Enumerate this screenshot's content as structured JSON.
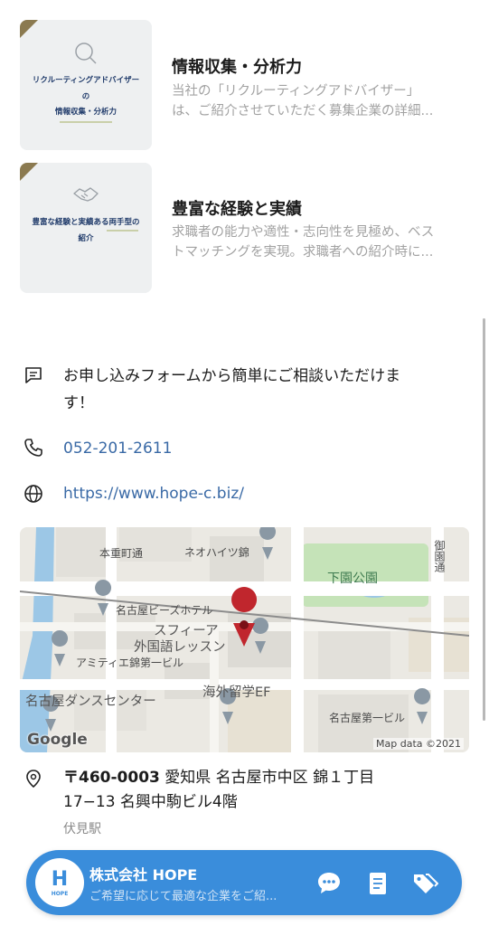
{
  "cards": [
    {
      "thumb_text_1": "リクルーティングアドバイザー",
      "thumb_text_2": "の",
      "thumb_text_3": "情報収集・分析力",
      "title": "情報収集・分析力",
      "desc_1": "当社の「リクルーティングアドバイザー」",
      "desc_2": "は、ご紹介させていただく募集企業の詳細..."
    },
    {
      "thumb_text_1": "豊富な経験と実績ある両手型の",
      "thumb_text_2": "紹介",
      "title": "豊富な経験と実績",
      "desc_1": "求職者の能力や適性・志向性を見極め、ベス",
      "desc_2": "トマッチングを実現。求職者への紹介時に..."
    }
  ],
  "contact": {
    "message_1": "お申し込みフォームから簡単にご相談いただけま",
    "message_2": "す！",
    "phone": "052-201-2611",
    "website": "https://www.hope-c.biz/"
  },
  "map": {
    "labels": {
      "street1": "本重町通",
      "building1": "ネオハイツ錦",
      "park": "下園公園",
      "street2": "御園通",
      "hotel": "名古屋ビーズホテル",
      "school_1": "スフィーア",
      "school_2": "外国語レッスン",
      "building2": "アミティエ錦第一ビル",
      "dance": "名古屋ダンスセンター",
      "ef": "海外留学EF",
      "building3": "名古屋第一ビル"
    },
    "google": "Google",
    "attribution": "Map data ©2021"
  },
  "address": {
    "line1_bold": "〒460-0003",
    "line1_rest": " 愛知県 名古屋市中区 錦１丁目",
    "line2": "17−13 名興中駒ビル4階",
    "station": "伏見駅"
  },
  "bottom_bar": {
    "logo_mark": "H",
    "logo_text": "HOPE",
    "company": "株式会社 HOPE",
    "subtitle": "ご希望に応じて最適な企業をご紹...",
    "icons": [
      "chat-icon",
      "document-icon",
      "tags-icon"
    ]
  },
  "colors": {
    "accent": "#3a8ddb",
    "link": "#3a6aa6",
    "pin": "#c0262d"
  }
}
